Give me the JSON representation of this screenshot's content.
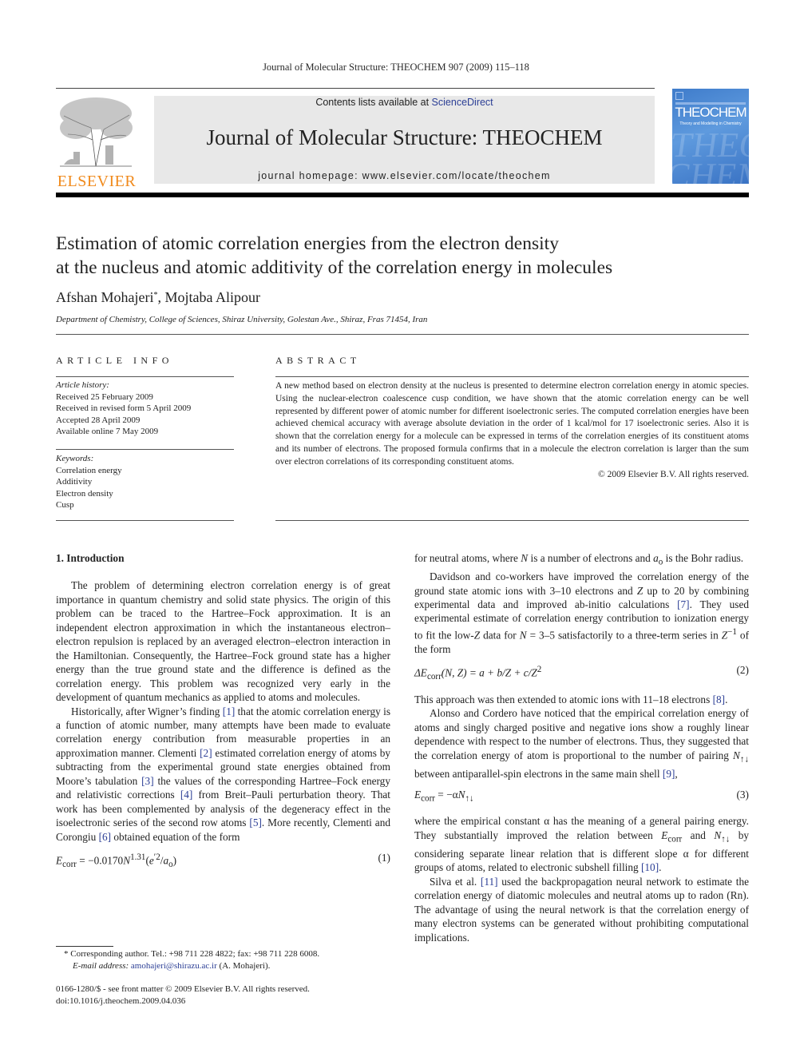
{
  "running_head": "Journal of Molecular Structure: THEOCHEM 907 (2009) 115–118",
  "header": {
    "publisher_logo_text": "ELSEVIER",
    "contents_prefix": "Contents lists available at ",
    "contents_link": "ScienceDirect",
    "journal_name": "Journal of Molecular Structure: THEOCHEM",
    "homepage": "journal homepage: www.elsevier.com/locate/theochem",
    "cover_title": "THEOCHEM",
    "cover_subtitle": "Theory and Modelling in Chemistry",
    "cover_watermark": "THEO CHEM"
  },
  "article": {
    "title_line1": "Estimation of atomic correlation energies from the electron density",
    "title_line2": "at the nucleus and atomic additivity of the correlation energy in molecules",
    "author1": "Afshan Mohajeri",
    "author1_mark": "*",
    "author_sep": ", ",
    "author2": "Mojtaba Alipour",
    "affiliation": "Department of Chemistry, College of Sciences, Shiraz University, Golestan Ave., Shiraz, Fras 71454, Iran"
  },
  "article_info": {
    "heading": "ARTICLE INFO",
    "history_label": "Article history:",
    "history": [
      "Received 25 February 2009",
      "Received in revised form 5 April 2009",
      "Accepted 28 April 2009",
      "Available online 7 May 2009"
    ],
    "keywords_label": "Keywords:",
    "keywords": [
      "Correlation energy",
      "Additivity",
      "Electron density",
      "Cusp"
    ]
  },
  "abstract": {
    "heading": "ABSTRACT",
    "text": "A new method based on electron density at the nucleus is presented to determine electron correlation energy in atomic species. Using the nuclear-electron coalescence cusp condition, we have shown that the atomic correlation energy can be well represented by different power of atomic number for different isoelectronic series. The computed correlation energies have been achieved chemical accuracy with average absolute deviation in the order of 1 kcal/mol for 17 isoelectronic series. Also it is shown that the correlation energy for a molecule can be expressed in terms of the correlation energies of its constituent atoms and its number of electrons. The proposed formula confirms that in a molecule the electron correlation is larger than the sum over electron correlations of its corresponding constituent atoms.",
    "copyright": "© 2009 Elsevier B.V. All rights reserved."
  },
  "body": {
    "section_heading": "1. Introduction",
    "p1": "The problem of determining electron correlation energy is of great importance in quantum chemistry and solid state physics. The origin of this problem can be traced to the Hartree–Fock approximation. It is an independent electron approximation in which the instantaneous electron–electron repulsion is replaced by an averaged electron–electron interaction in the Hamiltonian. Consequently, the Hartree–Fock ground state has a higher energy than the true ground state and the difference is defined as the correlation energy. This problem was recognized very early in the development of quantum mechanics as applied to atoms and molecules.",
    "p2_a": "Historically, after Wigner’s finding ",
    "ref1": "[1]",
    "p2_b": " that the atomic correlation energy is a function of atomic number, many attempts have been made to evaluate correlation energy contribution from measurable properties in an approximation manner. Clementi ",
    "ref2": "[2]",
    "p2_c": " estimated correlation energy of atoms by subtracting from the experimental ground state energies obtained from Moore’s tabulation ",
    "ref3": "[3]",
    "p2_d": " the values of the corresponding Hartree–Fock energy and relativistic corrections ",
    "ref4": "[4]",
    "p2_e": " from Breit–Pauli perturbation theory. That work has been complemented by analysis of the degeneracy effect in the isoelectronic series of the second row atoms ",
    "ref5": "[5]",
    "p2_f": ". More recently, Clementi and Corongiu ",
    "ref6": "[6]",
    "p2_g": " obtained equation of the form",
    "eq1_lhs": "E",
    "eq1_sub": "corr",
    "eq1_mid": " = −0.0170",
    "eq1_N": "N",
    "eq1_exp": "1.31",
    "eq1_paren_open": "(",
    "eq1_e": "e",
    "eq1_e_exp": "′2",
    "eq1_slash": "/",
    "eq1_a": "a",
    "eq1_a_sub": "o",
    "eq1_paren_close": ")",
    "eq1_num": "(1)",
    "c2_p1_a": "for neutral atoms, where ",
    "c2_p1_N": "N",
    "c2_p1_b": " is a number of electrons and ",
    "c2_p1_a0": "a",
    "c2_p1_a0_sub": "o",
    "c2_p1_c": " is the Bohr radius.",
    "c2_p2_a": "Davidson and co-workers have improved the correlation energy of the ground state atomic ions with 3–10 electrons and ",
    "c2_p2_Z": "Z",
    "c2_p2_b": " up to 20 by combining experimental data and improved ab-initio calculations ",
    "ref7": "[7]",
    "c2_p2_c": ". They used experimental estimate of correlation energy contribution to ionization energy to fit the low-",
    "c2_p2_Z2": "Z",
    "c2_p2_d": " data for ",
    "c2_p2_N": "N",
    "c2_p2_e": " = 3–5 satisfactorily to a three-term series in ",
    "c2_p2_Z3": "Z",
    "c2_p2_exp": "−1",
    "c2_p2_f": " of the form",
    "eq2_math": "ΔE",
    "eq2_sub": "corr",
    "eq2_rest": "(N, Z) = a + b/Z + c/Z",
    "eq2_exp": "2",
    "eq2_num": "(2)",
    "c2_p3_a": "This approach was then extended to atomic ions with 11–18 electrons ",
    "ref8": "[8]",
    "c2_p3_b": ".",
    "c2_p4_a": "Alonso and Cordero have noticed that the empirical correlation energy of atoms and singly charged positive and negative ions show a roughly linear dependence with respect to the number of electrons. Thus, they suggested that the correlation energy of atom is proportional to the number of pairing ",
    "c2_p4_N": "N",
    "c2_p4_Nsub": "↑↓",
    "c2_p4_b": " between antiparallel-spin electrons in the same main shell ",
    "ref9": "[9]",
    "c2_p4_c": ",",
    "eq3_E": "E",
    "eq3_sub": "corr",
    "eq3_mid": " = −α",
    "eq3_N": "N",
    "eq3_Nsub": "↑↓",
    "eq3_num": "(3)",
    "c2_p5_a": "where the empirical constant α has the meaning of a general pairing energy. They substantially improved the relation between ",
    "c2_p5_E": "E",
    "c2_p5_Esub": "corr",
    "c2_p5_b": " and ",
    "c2_p5_N": "N",
    "c2_p5_Nsub": "↑↓",
    "c2_p5_c": " by considering separate linear relation that is different slope α for different groups of atoms, related to electronic subshell filling ",
    "ref10": "[10]",
    "c2_p5_d": ".",
    "c2_p6_a": "Silva et al. ",
    "ref11": "[11]",
    "c2_p6_b": " used the backpropagation neural network to estimate the correlation energy of diatomic molecules and neutral atoms up to radon (Rn). The advantage of using the neural network is that the correlation energy of many electron systems can be generated without prohibiting computational implications."
  },
  "footnote": {
    "mark": "*",
    "line1": " Corresponding author. Tel.: +98 711 228 4822; fax: +98 711 228 6008.",
    "email_label": "E-mail address:",
    "email": "amohajeri@shirazu.ac.ir",
    "email_suffix": " (A. Mohajeri)."
  },
  "frontmatter": {
    "issn_line": "0166-1280/$ - see front matter © 2009 Elsevier B.V. All rights reserved.",
    "doi": "doi:10.1016/j.theochem.2009.04.036"
  },
  "colors": {
    "link": "#2b3e95",
    "elsevier_orange": "#f08a1c",
    "masthead_bg": "#e8e8e8",
    "cover_blue": "#4a86d2"
  }
}
